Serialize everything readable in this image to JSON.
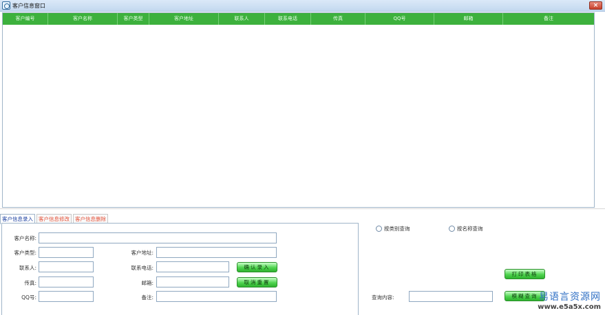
{
  "window": {
    "title": "客户信息窗口",
    "close_label": "×"
  },
  "grid": {
    "columns": [
      "客户编号",
      "客户名称",
      "客户类型",
      "客户地址",
      "联系人",
      "联系电话",
      "传真",
      "QQ号",
      "邮箱",
      "备注"
    ]
  },
  "tabs": [
    "客户信息录入",
    "客户信息修改",
    "客户信息删除"
  ],
  "form": {
    "name_label": "客户名称:",
    "type_label": "客户类型:",
    "address_label": "客户地址:",
    "contact_label": "联系人:",
    "phone_label": "联系电话:",
    "fax_label": "传真:",
    "email_label": "邮箱:",
    "qq_label": "QQ号:",
    "note_label": "备注:",
    "confirm_button": "确认录入",
    "cancel_button": "取消重置"
  },
  "query": {
    "radio_by_type": "按类别查询",
    "radio_by_name": "按名称查询",
    "content_label": "查询内容:",
    "print_button": "打印表格",
    "query_button": "模糊查询"
  },
  "watermark": {
    "main": "易语言资源网",
    "url": "www.e5a5x.com"
  }
}
